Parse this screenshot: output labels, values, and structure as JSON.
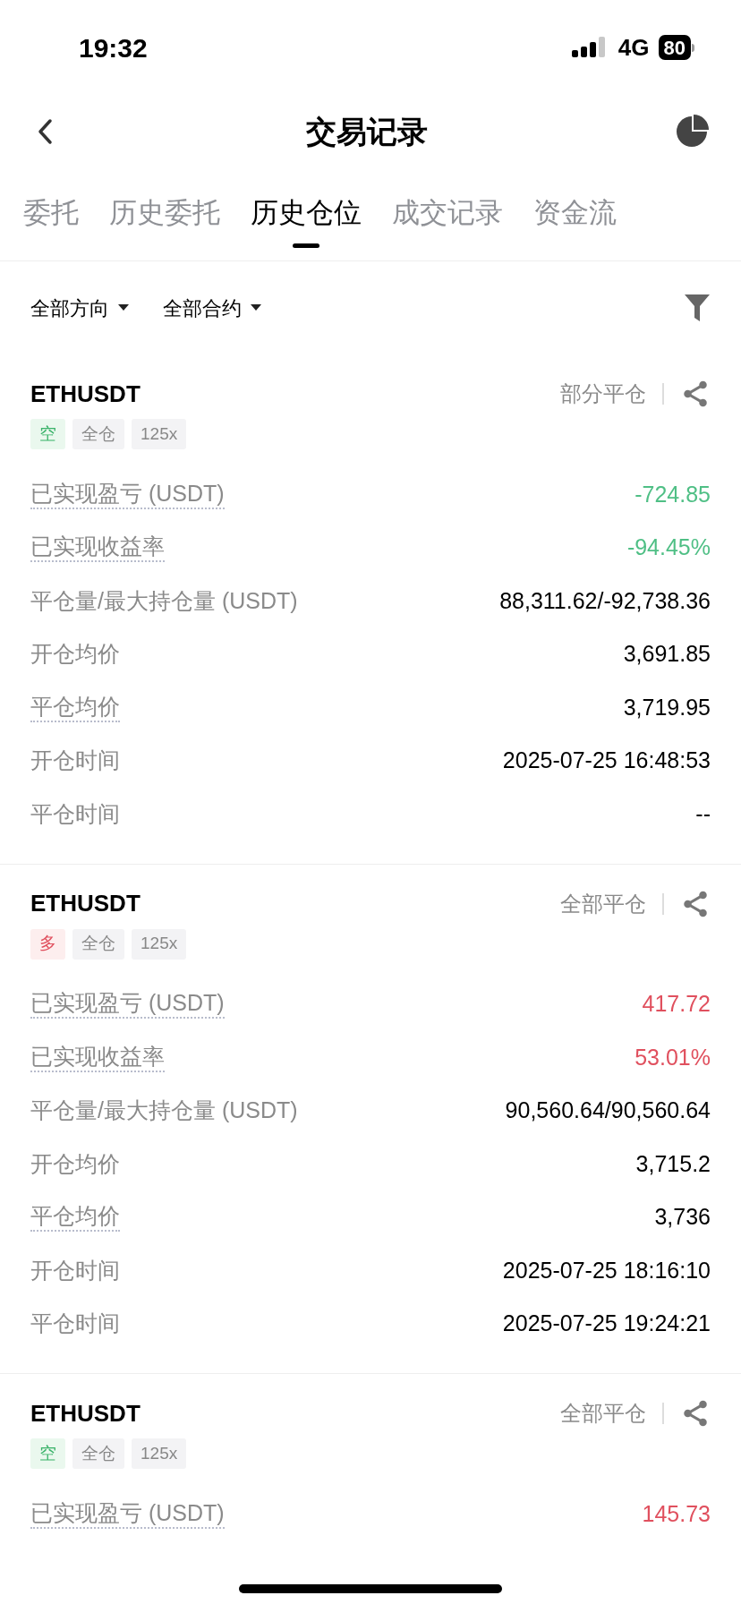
{
  "status_bar": {
    "time": "19:32",
    "network": "4G",
    "battery": "80"
  },
  "header": {
    "title": "交易记录"
  },
  "tabs": [
    {
      "label": "委托",
      "selected": false
    },
    {
      "label": "历史委托",
      "selected": false
    },
    {
      "label": "历史仓位",
      "selected": true
    },
    {
      "label": "成交记录",
      "selected": false
    },
    {
      "label": "资金流",
      "selected": false
    }
  ],
  "filters": [
    {
      "label": "全部方向"
    },
    {
      "label": "全部合约"
    }
  ],
  "positions": [
    {
      "symbol": "ETHUSDT",
      "status": "部分平仓",
      "tags": [
        {
          "label": "空",
          "kind": "short"
        },
        {
          "label": "全仓",
          "kind": "plain"
        },
        {
          "label": "125x",
          "kind": "plain"
        }
      ],
      "rows": [
        {
          "label": "已实现盈亏 (USDT)",
          "value": "-724.85",
          "dotted": true,
          "kind": "loss"
        },
        {
          "label": "已实现收益率",
          "value": "-94.45%",
          "dotted": true,
          "kind": "loss"
        },
        {
          "label": "平仓量/最大持仓量 (USDT)",
          "value": "88,311.62/-92,738.36",
          "dotted": false,
          "kind": "plain"
        },
        {
          "label": "开仓均价",
          "value": "3,691.85",
          "dotted": false,
          "kind": "plain"
        },
        {
          "label": "平仓均价",
          "value": "3,719.95",
          "dotted": true,
          "kind": "plain"
        },
        {
          "label": "开仓时间",
          "value": "2025-07-25 16:48:53",
          "dotted": false,
          "kind": "plain"
        },
        {
          "label": "平仓时间",
          "value": "--",
          "dotted": false,
          "kind": "plain"
        }
      ]
    },
    {
      "symbol": "ETHUSDT",
      "status": "全部平仓",
      "tags": [
        {
          "label": "多",
          "kind": "long"
        },
        {
          "label": "全仓",
          "kind": "plain"
        },
        {
          "label": "125x",
          "kind": "plain"
        }
      ],
      "rows": [
        {
          "label": "已实现盈亏 (USDT)",
          "value": "417.72",
          "dotted": true,
          "kind": "profit"
        },
        {
          "label": "已实现收益率",
          "value": "53.01%",
          "dotted": true,
          "kind": "profit"
        },
        {
          "label": "平仓量/最大持仓量 (USDT)",
          "value": "90,560.64/90,560.64",
          "dotted": false,
          "kind": "plain"
        },
        {
          "label": "开仓均价",
          "value": "3,715.2",
          "dotted": false,
          "kind": "plain"
        },
        {
          "label": "平仓均价",
          "value": "3,736",
          "dotted": true,
          "kind": "plain"
        },
        {
          "label": "开仓时间",
          "value": "2025-07-25 18:16:10",
          "dotted": false,
          "kind": "plain"
        },
        {
          "label": "平仓时间",
          "value": "2025-07-25 19:24:21",
          "dotted": false,
          "kind": "plain"
        }
      ]
    },
    {
      "symbol": "ETHUSDT",
      "status": "全部平仓",
      "tags": [
        {
          "label": "空",
          "kind": "short"
        },
        {
          "label": "全仓",
          "kind": "plain"
        },
        {
          "label": "125x",
          "kind": "plain"
        }
      ],
      "rows": [
        {
          "label": "已实现盈亏 (USDT)",
          "value": "145.73",
          "dotted": true,
          "kind": "profit"
        }
      ]
    }
  ]
}
